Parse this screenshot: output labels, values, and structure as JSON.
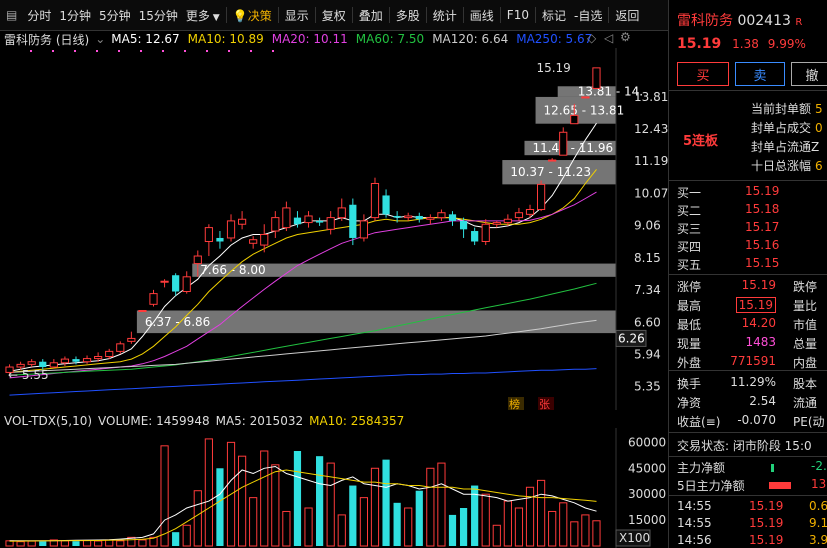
{
  "toolbar": {
    "menu_icon": "grid-menu-icon",
    "items": [
      "分时",
      "1分钟",
      "5分钟",
      "15分钟",
      "更多",
      "决策",
      "显示",
      "复权",
      "叠加",
      "多股",
      "统计",
      "画线",
      "F10",
      "标记",
      "-自选",
      "返回"
    ],
    "decision_icon": "bulb-icon"
  },
  "chart_header": {
    "name": "雷科防务 (日线)",
    "ma": [
      {
        "label": "MA5: 12.67",
        "color": "#ffffff"
      },
      {
        "label": "MA10: 10.89",
        "color": "#f0d000"
      },
      {
        "label": "MA20: 10.11",
        "color": "#e040e0"
      },
      {
        "label": "MA60: 7.50",
        "color": "#22c040"
      },
      {
        "label": "MA120: 6.64",
        "color": "#cccccc"
      },
      {
        "label": "MA250: 5.67",
        "color": "#2050ff"
      }
    ]
  },
  "price_axis": {
    "labels": [
      "13.81",
      "12.43",
      "11.19",
      "10.07",
      "9.06",
      "8.15",
      "7.34",
      "6.60",
      "5.94",
      "5.35"
    ],
    "current_tag": "6.26"
  },
  "chart_annotations": {
    "high_label": "15.19",
    "low_label": "5.55",
    "zones": [
      "13.81 - 14.",
      "12.65 - 13.81",
      "11.41 - 11.96",
      "10.37 - 11.23",
      "7.66 - 8.00",
      "6.37 - 6.86"
    ],
    "badges": [
      "榜",
      "张"
    ]
  },
  "chart_data": {
    "type": "candlestick",
    "title": "雷科防务 (日线)",
    "candles": [
      {
        "o": 5.6,
        "c": 5.7,
        "h": 5.75,
        "l": 5.55
      },
      {
        "o": 5.7,
        "c": 5.75,
        "h": 5.8,
        "l": 5.65
      },
      {
        "o": 5.75,
        "c": 5.8,
        "h": 5.85,
        "l": 5.7
      },
      {
        "o": 5.8,
        "c": 5.7,
        "h": 5.85,
        "l": 5.65
      },
      {
        "o": 5.7,
        "c": 5.78,
        "h": 5.85,
        "l": 5.68
      },
      {
        "o": 5.78,
        "c": 5.85,
        "h": 5.9,
        "l": 5.72
      },
      {
        "o": 5.85,
        "c": 5.8,
        "h": 5.9,
        "l": 5.75
      },
      {
        "o": 5.8,
        "c": 5.86,
        "h": 5.92,
        "l": 5.76
      },
      {
        "o": 5.86,
        "c": 5.9,
        "h": 5.98,
        "l": 5.8
      },
      {
        "o": 5.9,
        "c": 6.0,
        "h": 6.05,
        "l": 5.85
      },
      {
        "o": 6.0,
        "c": 6.15,
        "h": 6.2,
        "l": 5.95
      },
      {
        "o": 6.2,
        "c": 6.26,
        "h": 6.4,
        "l": 6.15
      },
      {
        "o": 6.86,
        "c": 6.86,
        "h": 6.86,
        "l": 6.86
      },
      {
        "o": 7.0,
        "c": 7.25,
        "h": 7.34,
        "l": 6.95
      },
      {
        "o": 7.55,
        "c": 7.55,
        "h": 7.6,
        "l": 7.4
      },
      {
        "o": 7.7,
        "c": 7.3,
        "h": 7.75,
        "l": 7.2
      },
      {
        "o": 7.3,
        "c": 7.66,
        "h": 7.8,
        "l": 7.25
      },
      {
        "o": 8.0,
        "c": 8.2,
        "h": 8.35,
        "l": 7.66
      },
      {
        "o": 8.6,
        "c": 9.0,
        "h": 9.1,
        "l": 8.2
      },
      {
        "o": 8.7,
        "c": 8.6,
        "h": 8.9,
        "l": 8.4
      },
      {
        "o": 8.7,
        "c": 9.2,
        "h": 9.4,
        "l": 8.6
      },
      {
        "o": 9.1,
        "c": 9.25,
        "h": 9.5,
        "l": 8.95
      },
      {
        "o": 8.55,
        "c": 8.65,
        "h": 8.75,
        "l": 8.4
      },
      {
        "o": 8.5,
        "c": 8.8,
        "h": 9.1,
        "l": 8.3
      },
      {
        "o": 8.9,
        "c": 9.3,
        "h": 9.5,
        "l": 8.7
      },
      {
        "o": 9.0,
        "c": 9.6,
        "h": 9.8,
        "l": 8.9
      },
      {
        "o": 9.3,
        "c": 9.1,
        "h": 9.5,
        "l": 9.0
      },
      {
        "o": 9.15,
        "c": 9.35,
        "h": 9.5,
        "l": 9.0
      },
      {
        "o": 9.2,
        "c": 9.15,
        "h": 9.3,
        "l": 9.05
      },
      {
        "o": 8.95,
        "c": 9.3,
        "h": 9.5,
        "l": 8.8
      },
      {
        "o": 9.3,
        "c": 9.6,
        "h": 9.9,
        "l": 9.2
      },
      {
        "o": 9.7,
        "c": 8.7,
        "h": 9.9,
        "l": 8.5
      },
      {
        "o": 8.7,
        "c": 9.2,
        "h": 9.4,
        "l": 8.6
      },
      {
        "o": 9.3,
        "c": 10.4,
        "h": 10.6,
        "l": 9.2
      },
      {
        "o": 10.0,
        "c": 9.4,
        "h": 10.2,
        "l": 9.3
      },
      {
        "o": 9.35,
        "c": 9.3,
        "h": 9.5,
        "l": 9.15
      },
      {
        "o": 9.3,
        "c": 9.35,
        "h": 9.45,
        "l": 9.2
      },
      {
        "o": 9.35,
        "c": 9.25,
        "h": 9.45,
        "l": 9.15
      },
      {
        "o": 9.25,
        "c": 9.3,
        "h": 9.4,
        "l": 9.1
      },
      {
        "o": 9.3,
        "c": 9.45,
        "h": 9.55,
        "l": 9.2
      },
      {
        "o": 9.4,
        "c": 9.2,
        "h": 9.5,
        "l": 9.05
      },
      {
        "o": 9.2,
        "c": 8.95,
        "h": 9.3,
        "l": 8.7
      },
      {
        "o": 8.9,
        "c": 8.6,
        "h": 9.0,
        "l": 8.5
      },
      {
        "o": 8.6,
        "c": 9.1,
        "h": 9.25,
        "l": 8.5
      },
      {
        "o": 9.1,
        "c": 9.15,
        "h": 9.2,
        "l": 9.0
      },
      {
        "o": 9.15,
        "c": 9.25,
        "h": 9.4,
        "l": 9.05
      },
      {
        "o": 9.3,
        "c": 9.45,
        "h": 9.6,
        "l": 9.2
      },
      {
        "o": 9.4,
        "c": 9.55,
        "h": 9.7,
        "l": 9.3
      },
      {
        "o": 9.55,
        "c": 10.37,
        "h": 10.5,
        "l": 9.5
      },
      {
        "o": 11.23,
        "c": 11.23,
        "h": 11.3,
        "l": 11.23
      },
      {
        "o": 11.41,
        "c": 12.3,
        "h": 12.5,
        "l": 11.41
      },
      {
        "o": 12.65,
        "c": 13.0,
        "h": 13.5,
        "l": 12.65
      },
      {
        "o": 13.81,
        "c": 13.81,
        "h": 13.81,
        "l": 13.81
      },
      {
        "o": 14.2,
        "c": 15.19,
        "h": 15.19,
        "l": 14.2
      }
    ],
    "ma_lines": [
      {
        "name": "MA5",
        "color": "#ffffff",
        "points": [
          5.62,
          5.66,
          5.7,
          5.72,
          5.74,
          5.76,
          5.78,
          5.8,
          5.82,
          5.86,
          5.94,
          6.05,
          6.3,
          6.6,
          6.95,
          7.2,
          7.4,
          7.6,
          7.95,
          8.2,
          8.5,
          8.7,
          8.8,
          8.8,
          8.9,
          9.0,
          9.1,
          9.2,
          9.2,
          9.2,
          9.3,
          9.2,
          9.2,
          9.4,
          9.4,
          9.3,
          9.35,
          9.3,
          9.3,
          9.3,
          9.3,
          9.2,
          9.05,
          9.0,
          9.0,
          9.05,
          9.15,
          9.3,
          9.6,
          10.0,
          10.6,
          11.3,
          12.0,
          12.67
        ]
      },
      {
        "name": "MA10",
        "color": "#f0d000",
        "points": [
          5.6,
          5.62,
          5.64,
          5.66,
          5.68,
          5.7,
          5.72,
          5.74,
          5.76,
          5.78,
          5.8,
          5.85,
          5.95,
          6.1,
          6.3,
          6.5,
          6.75,
          7.0,
          7.3,
          7.55,
          7.8,
          8.05,
          8.25,
          8.4,
          8.55,
          8.7,
          8.8,
          8.85,
          8.9,
          8.95,
          9.0,
          9.05,
          9.1,
          9.2,
          9.25,
          9.2,
          9.2,
          9.25,
          9.3,
          9.3,
          9.3,
          9.25,
          9.2,
          9.15,
          9.1,
          9.1,
          9.1,
          9.15,
          9.25,
          9.4,
          9.6,
          9.9,
          10.4,
          10.89
        ]
      },
      {
        "name": "MA20",
        "color": "#e040e0",
        "points": [
          5.5,
          5.52,
          5.54,
          5.56,
          5.58,
          5.6,
          5.62,
          5.64,
          5.66,
          5.68,
          5.7,
          5.72,
          5.76,
          5.82,
          5.9,
          6.0,
          6.1,
          6.25,
          6.4,
          6.55,
          6.75,
          6.95,
          7.15,
          7.35,
          7.55,
          7.75,
          7.95,
          8.1,
          8.25,
          8.4,
          8.55,
          8.65,
          8.75,
          8.85,
          8.9,
          8.95,
          9.0,
          9.05,
          9.1,
          9.15,
          9.2,
          9.2,
          9.2,
          9.2,
          9.2,
          9.2,
          9.2,
          9.22,
          9.3,
          9.4,
          9.55,
          9.7,
          9.9,
          10.11
        ]
      },
      {
        "name": "MA60",
        "color": "#22c040",
        "points": [
          5.55,
          5.56,
          5.57,
          5.58,
          5.59,
          5.6,
          5.61,
          5.62,
          5.63,
          5.64,
          5.65,
          5.66,
          5.68,
          5.7,
          5.72,
          5.74,
          5.77,
          5.8,
          5.83,
          5.86,
          5.9,
          5.94,
          5.98,
          6.02,
          6.06,
          6.1,
          6.14,
          6.18,
          6.22,
          6.26,
          6.3,
          6.34,
          6.38,
          6.42,
          6.47,
          6.52,
          6.57,
          6.62,
          6.67,
          6.72,
          6.77,
          6.82,
          6.87,
          6.92,
          6.97,
          7.02,
          7.07,
          7.12,
          7.18,
          7.24,
          7.3,
          7.36,
          7.43,
          7.5
        ]
      },
      {
        "name": "MA120",
        "color": "#cccccc",
        "points": [
          5.6,
          5.61,
          5.62,
          5.63,
          5.64,
          5.65,
          5.66,
          5.67,
          5.68,
          5.69,
          5.7,
          5.71,
          5.72,
          5.73,
          5.74,
          5.75,
          5.77,
          5.79,
          5.81,
          5.83,
          5.85,
          5.87,
          5.89,
          5.91,
          5.93,
          5.95,
          5.97,
          5.99,
          6.01,
          6.03,
          6.05,
          6.07,
          6.09,
          6.11,
          6.13,
          6.15,
          6.17,
          6.19,
          6.21,
          6.23,
          6.25,
          6.27,
          6.29,
          6.31,
          6.34,
          6.37,
          6.4,
          6.43,
          6.46,
          6.5,
          6.54,
          6.58,
          6.61,
          6.64
        ]
      },
      {
        "name": "MA250",
        "color": "#2050ff",
        "points": [
          5.2,
          5.21,
          5.22,
          5.23,
          5.24,
          5.25,
          5.26,
          5.27,
          5.28,
          5.29,
          5.3,
          5.31,
          5.32,
          5.33,
          5.34,
          5.35,
          5.36,
          5.37,
          5.38,
          5.39,
          5.4,
          5.41,
          5.42,
          5.43,
          5.44,
          5.45,
          5.46,
          5.47,
          5.48,
          5.49,
          5.5,
          5.51,
          5.52,
          5.53,
          5.54,
          5.55,
          5.56,
          5.56,
          5.57,
          5.57,
          5.58,
          5.58,
          5.59,
          5.59,
          5.6,
          5.61,
          5.62,
          5.63,
          5.64,
          5.64,
          5.65,
          5.66,
          5.66,
          5.67
        ]
      }
    ],
    "price_range": [
      5.15,
      16.0
    ],
    "volume": {
      "label": "VOL-TDX(5,10)",
      "volume_text": "VOLUME: 1459948",
      "ma5_text": "MA5: 2015032",
      "ma10_text": "MA10: 2584357",
      "unit": "X100",
      "axis_labels": [
        "60000",
        "45000",
        "30000",
        "15000"
      ],
      "values": [
        3000,
        2500,
        2800,
        2600,
        3500,
        3000,
        2800,
        3200,
        2900,
        3500,
        3000,
        5000,
        3500,
        5000,
        58000,
        8000,
        12000,
        32000,
        62000,
        45000,
        60000,
        52000,
        28000,
        55000,
        47000,
        20000,
        55000,
        22000,
        52000,
        48000,
        18000,
        35000,
        28000,
        45000,
        50000,
        25000,
        22000,
        32000,
        45000,
        48000,
        18000,
        22000,
        35000,
        30000,
        12000,
        26000,
        22000,
        34000,
        38000,
        20000,
        25000,
        14000,
        18000,
        14600
      ],
      "ma5": [
        3000,
        3000,
        3000,
        3000,
        3000,
        3200,
        3300,
        3400,
        3500,
        3600,
        4000,
        4500,
        5000,
        7000,
        15000,
        18000,
        22000,
        24000,
        26000,
        30000,
        38000,
        44000,
        42000,
        45000,
        46000,
        42000,
        40000,
        38000,
        36000,
        35000,
        38000,
        40000,
        36000,
        35000,
        34000,
        36000,
        35000,
        33000,
        34000,
        36000,
        33000,
        30000,
        30000,
        29000,
        28000,
        26000,
        27000,
        28000,
        30000,
        29000,
        27000,
        25000,
        22000,
        20150
      ],
      "ma10": [
        2800,
        2850,
        2900,
        2950,
        3000,
        3050,
        3100,
        3150,
        3200,
        3300,
        3400,
        3600,
        3900,
        4500,
        7000,
        10000,
        14000,
        18000,
        22000,
        26000,
        30000,
        34000,
        37000,
        40000,
        43000,
        44000,
        43000,
        42000,
        41000,
        40000,
        39000,
        38000,
        37000,
        37000,
        36000,
        36000,
        35000,
        35000,
        34000,
        34000,
        34000,
        33000,
        33000,
        32000,
        31000,
        30000,
        29000,
        28500,
        28000,
        28000,
        27500,
        27000,
        26500,
        25840
      ]
    },
    "ylim_volume": [
      0,
      66000
    ]
  },
  "right_panel": {
    "stock_name": "雷科防务",
    "stock_code": "002413",
    "r_badge": "R",
    "price": "15.19",
    "change": "1.38",
    "pct": "9.99%",
    "buy_btn": "买",
    "sell_btn": "卖",
    "cancel_btn": "撤",
    "streak": "5连板",
    "info": [
      {
        "k": "当前封单额",
        "v": "5"
      },
      {
        "k": "封单占成交",
        "v": "0"
      },
      {
        "k": "封单占流通Z",
        "v": ""
      },
      {
        "k": "十日总涨幅",
        "v": "6"
      }
    ],
    "bids": [
      {
        "k": "买一",
        "p": "15.19",
        "v": ""
      },
      {
        "k": "买二",
        "p": "15.18",
        "v": ""
      },
      {
        "k": "买三",
        "p": "15.17",
        "v": ""
      },
      {
        "k": "买四",
        "p": "15.16",
        "v": ""
      },
      {
        "k": "买五",
        "p": "15.15",
        "v": ""
      }
    ],
    "stats": [
      {
        "k": "涨停",
        "v": "15.19",
        "k2": "跌停",
        "cls": "red"
      },
      {
        "k": "最高",
        "v": "15.19",
        "k2": "量比",
        "cls": "red"
      },
      {
        "k": "最低",
        "v": "14.20",
        "k2": "市值",
        "cls": "red"
      },
      {
        "k": "现量",
        "v": "1483",
        "k2": "总量",
        "cls": "pink"
      },
      {
        "k": "外盘",
        "v": "771591",
        "k2": "内盘",
        "cls": "red"
      }
    ],
    "stats2": [
      {
        "k": "换手",
        "v": "11.29%",
        "k2": "股本"
      },
      {
        "k": "净资",
        "v": "2.54",
        "k2": "流通"
      },
      {
        "k": "收益(≡)",
        "v": "-0.070",
        "k2": "PE(动"
      }
    ],
    "trade_status": "交易状态: 闭市阶段 15:0",
    "main_net": "主力净额",
    "main_net_val": "-2.",
    "main_net5": "5日主力净额",
    "main_net5_val": "13.",
    "ticks": [
      {
        "t": "14:55",
        "p": "15.19",
        "v": "0.6"
      },
      {
        "t": "14:55",
        "p": "15.19",
        "v": "9.1"
      },
      {
        "t": "14:56",
        "p": "15.19",
        "v": "3.9"
      }
    ]
  }
}
